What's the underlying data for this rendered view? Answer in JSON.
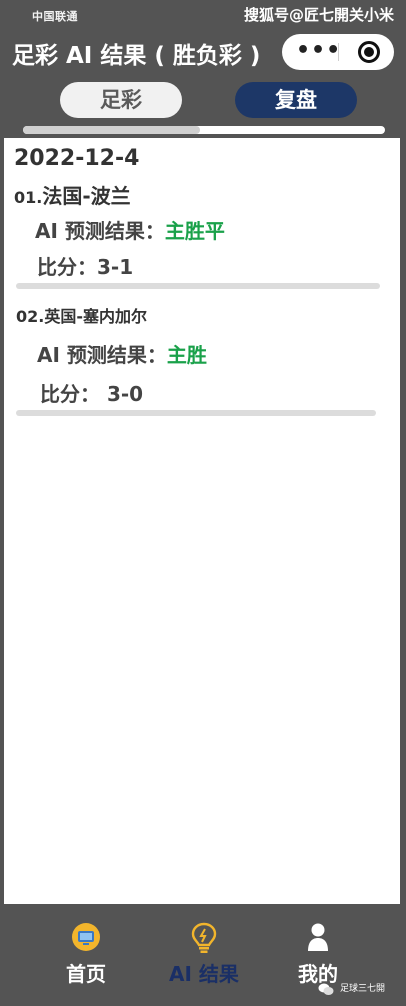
{
  "status_bar": {
    "carrier": "中国联通",
    "watermark": "搜狐号@匠七開关小米"
  },
  "title_bar": {
    "title": "足彩 AI 结果 ( 胜负彩 )",
    "more_icon": "more-dots-icon",
    "close_icon": "target-circle-icon"
  },
  "tabs": [
    {
      "label": "足彩"
    },
    {
      "label": "复盘"
    }
  ],
  "progress": {
    "fraction": 0.49
  },
  "content": {
    "date": "2022-12-4",
    "matches": [
      {
        "number": "01.",
        "teams": "法国-波兰",
        "pred_label": "AI 预测结果：",
        "pred_value": "主胜平",
        "score_label": "比分：",
        "score_value": "3-1"
      },
      {
        "number": "02.",
        "teams": "英国-塞内加尔",
        "pred_label": "AI 预测结果：",
        "pred_value": "主胜",
        "score_label": "比分：",
        "score_value": " 3-0"
      }
    ]
  },
  "bottom_nav": [
    {
      "label": "首页",
      "icon": "home-icon"
    },
    {
      "label": "AI 结果",
      "icon": "lightbulb-icon"
    },
    {
      "label": "我的",
      "icon": "user-icon"
    }
  ],
  "bottom_watermark": "足球三七開",
  "colors": {
    "accent_navy": "#1d3767",
    "prediction_green": "#1aa14a",
    "frame_gray": "#545454"
  }
}
